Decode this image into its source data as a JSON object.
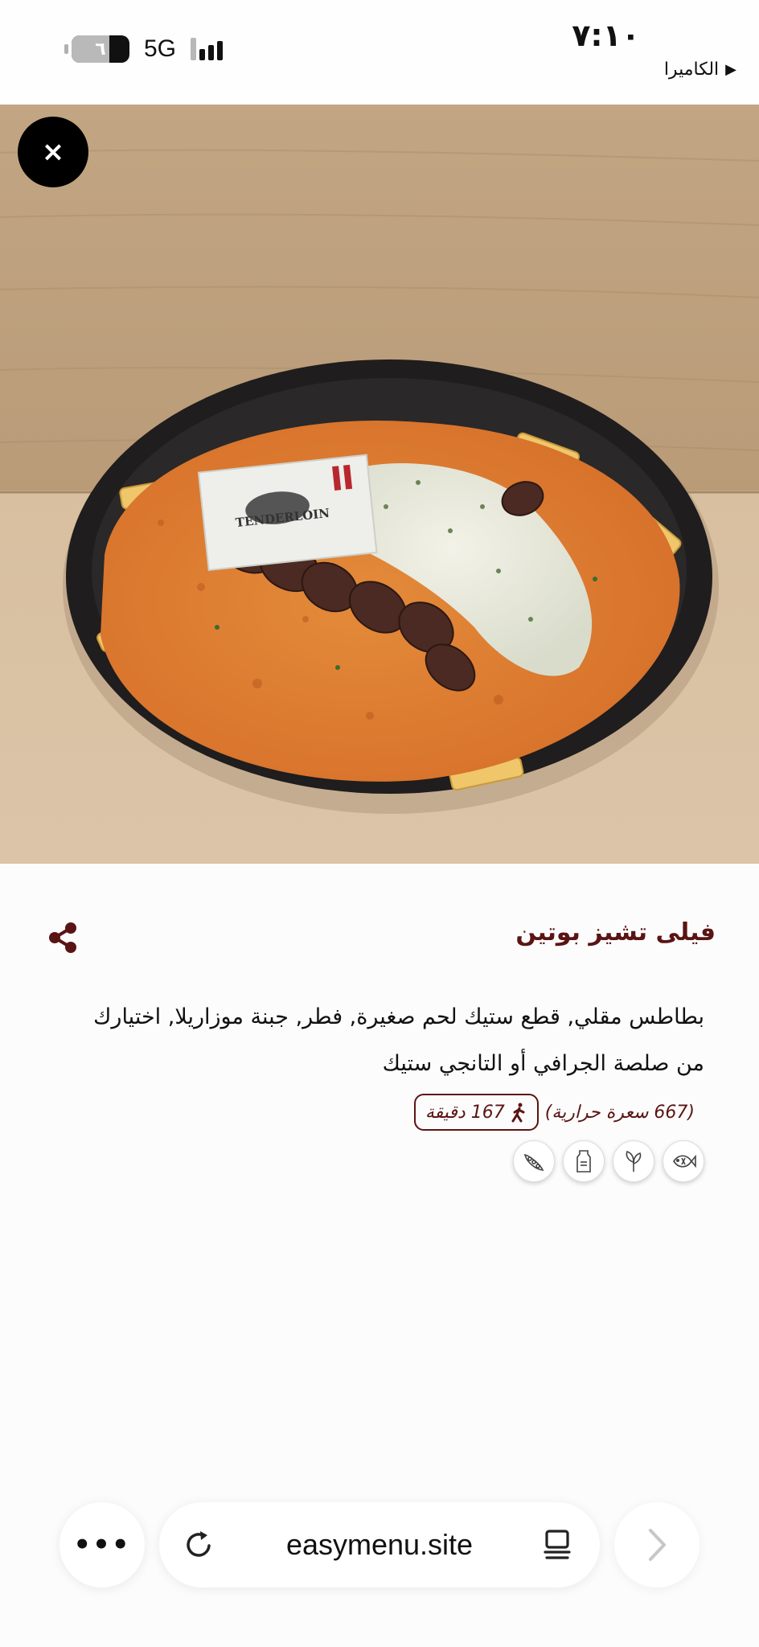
{
  "status_bar": {
    "time": "٧:١٠",
    "back_app": "الكاميرا",
    "network": "5G",
    "battery_label": "٦",
    "battery_level": 0.35
  },
  "product": {
    "close_symbol": "×",
    "title": "فيلى تشيز بوتين",
    "description": "بطاطس مقلي, قطع ستيك لحم صغيرة, فطر, جبنة موزاريلا, اختيارك من صلصة الجرافي أو التانجي ستيك",
    "calories": "(667 سعرة حرارية)",
    "walk_time": "167 دقيقة",
    "allergens": [
      "fish-icon",
      "celery-icon",
      "milk-icon",
      "peas-icon"
    ],
    "plate_flag_text": "TENDERLOIN"
  },
  "browser": {
    "more_label": "•••",
    "url": "easymenu.site"
  },
  "colors": {
    "accent": "#5a1414",
    "background": "#fdfcfc"
  }
}
